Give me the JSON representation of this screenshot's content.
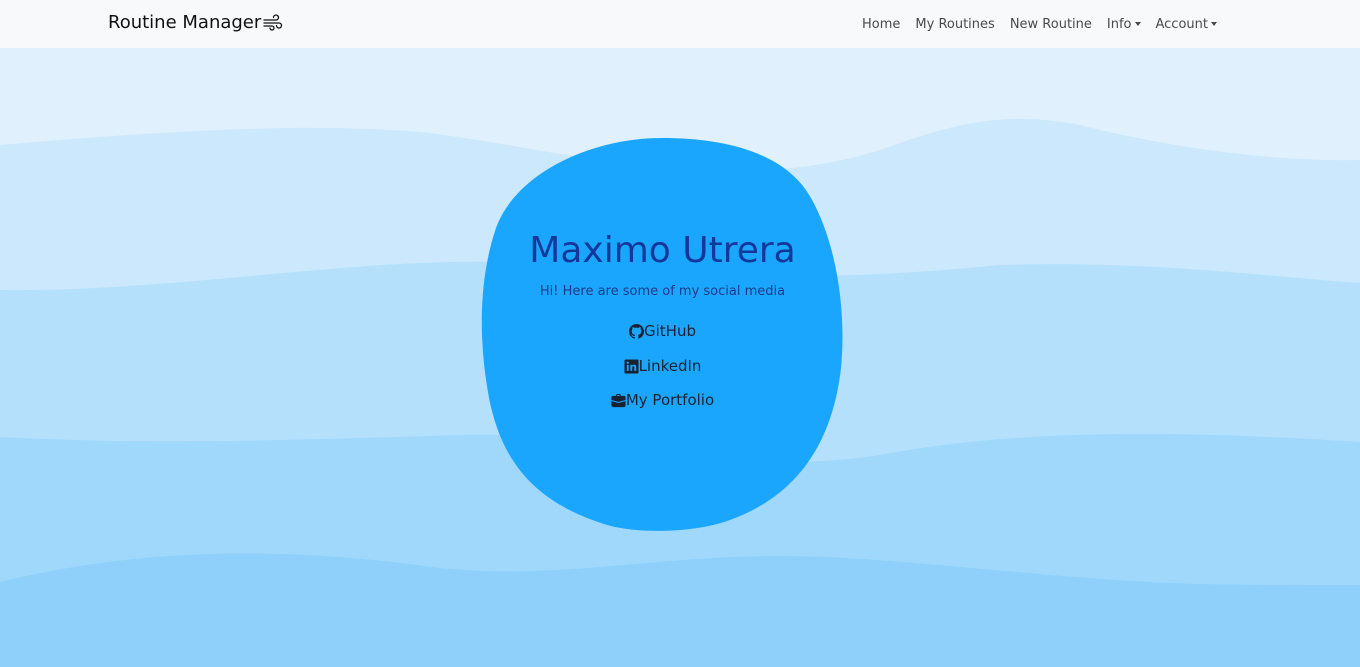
{
  "navbar": {
    "brand": "Routine Manager",
    "brand_icon": "wind-icon",
    "items": [
      {
        "label": "Home"
      },
      {
        "label": "My Routines"
      },
      {
        "label": "New Routine"
      },
      {
        "label": "Info",
        "dropdown": true
      },
      {
        "label": "Account",
        "dropdown": true
      }
    ]
  },
  "profile": {
    "name": "Maximo Utrera",
    "subtitle": "Hi! Here are some of my social media",
    "links": [
      {
        "label": "GitHub",
        "icon": "github-icon"
      },
      {
        "label": "LinkedIn",
        "icon": "linkedin-icon"
      },
      {
        "label": "My Portfolio",
        "icon": "briefcase-icon"
      }
    ]
  },
  "colors": {
    "blob": "#1ba6fd",
    "name": "#14379a",
    "navbar_bg": "#f8f9fa",
    "wave_1": "#cce8fc",
    "wave_2": "#b4e0fc",
    "wave_3": "#a0d8fb",
    "wave_4": "#8fd0fb"
  }
}
